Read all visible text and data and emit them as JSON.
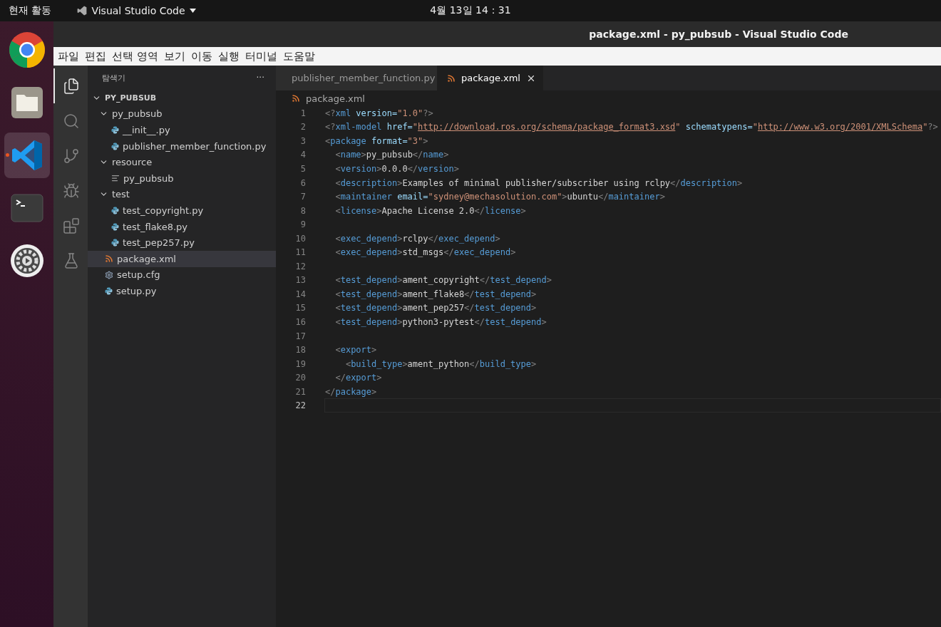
{
  "top_bar": {
    "activities": "현재 활동",
    "app_menu": "Visual Studio Code",
    "clock": "4월 13일 14：31"
  },
  "dock": [
    {
      "kind": "chrome",
      "selected": false,
      "running": false
    },
    {
      "kind": "files",
      "selected": false,
      "running": false
    },
    {
      "kind": "vscode",
      "selected": true,
      "running": true
    },
    {
      "kind": "terminal",
      "selected": false,
      "running": false
    },
    {
      "kind": "settings",
      "selected": false,
      "running": false
    }
  ],
  "window": {
    "title": "package.xml - py_pubsub - Visual Studio Code"
  },
  "menu": [
    "파일",
    "편집",
    "선택 영역",
    "보기",
    "이동",
    "실행",
    "터미널",
    "도움말"
  ],
  "activity_bar": [
    {
      "kind": "explorer",
      "selected": true
    },
    {
      "kind": "search",
      "selected": false
    },
    {
      "kind": "source-control",
      "selected": false
    },
    {
      "kind": "run",
      "selected": false
    },
    {
      "kind": "extensions",
      "selected": false
    },
    {
      "kind": "testing",
      "selected": false
    }
  ],
  "sidebar": {
    "title": "탐색기",
    "more": "···",
    "root": {
      "label": "PY_PUBSUB",
      "expanded": true,
      "children": [
        {
          "label": "py_pubsub",
          "kind": "folder",
          "expanded": true,
          "selected": false,
          "children": [
            {
              "label": "__init__.py",
              "kind": "python",
              "selected": false
            },
            {
              "label": "publisher_member_function.py",
              "kind": "python",
              "selected": false
            }
          ]
        },
        {
          "label": "resource",
          "kind": "folder",
          "expanded": true,
          "selected": false,
          "children": [
            {
              "label": "py_pubsub",
              "kind": "text",
              "selected": false
            }
          ]
        },
        {
          "label": "test",
          "kind": "folder",
          "expanded": true,
          "selected": false,
          "children": [
            {
              "label": "test_copyright.py",
              "kind": "python",
              "selected": false
            },
            {
              "label": "test_flake8.py",
              "kind": "python",
              "selected": false
            },
            {
              "label": "test_pep257.py",
              "kind": "python",
              "selected": false
            }
          ]
        },
        {
          "label": "package.xml",
          "kind": "xml",
          "selected": true
        },
        {
          "label": "setup.cfg",
          "kind": "config",
          "selected": false
        },
        {
          "label": "setup.py",
          "kind": "python",
          "selected": false
        }
      ]
    }
  },
  "tabs": [
    {
      "label": "publisher_member_function.py",
      "kind": "python",
      "selected": false
    },
    {
      "label": "package.xml",
      "kind": "xml",
      "selected": true
    }
  ],
  "breadcrumb": {
    "label": "package.xml",
    "kind": "xml"
  },
  "code": [
    {
      "number": "1",
      "current": false,
      "tokens": [
        {
          "kind": "punct",
          "text": "<?"
        },
        {
          "kind": "tag",
          "text": "xml"
        },
        {
          "kind": "attr",
          "text": " version="
        },
        {
          "kind": "string",
          "text": "\"1.0\""
        },
        {
          "kind": "punct",
          "text": "?>"
        }
      ]
    },
    {
      "number": "2",
      "current": false,
      "tokens": [
        {
          "kind": "punct",
          "text": "<?"
        },
        {
          "kind": "tag",
          "text": "xml-model"
        },
        {
          "kind": "attr",
          "text": " href="
        },
        {
          "kind": "string",
          "text": "\""
        },
        {
          "kind": "link",
          "text": "http://download.ros.org/schema/package_format3.xsd"
        },
        {
          "kind": "string",
          "text": "\""
        },
        {
          "kind": "attr",
          "text": " schematypens="
        },
        {
          "kind": "string",
          "text": "\""
        },
        {
          "kind": "link",
          "text": "http://www.w3.org/2001/XMLSchema"
        },
        {
          "kind": "string",
          "text": "\""
        },
        {
          "kind": "punct",
          "text": "?>"
        }
      ]
    },
    {
      "number": "3",
      "current": false,
      "tokens": [
        {
          "kind": "punct",
          "text": "<"
        },
        {
          "kind": "tag",
          "text": "package"
        },
        {
          "kind": "attr",
          "text": " format="
        },
        {
          "kind": "string",
          "text": "\"3\""
        },
        {
          "kind": "punct",
          "text": ">"
        }
      ]
    },
    {
      "number": "4",
      "current": false,
      "tokens": [
        {
          "kind": "punct",
          "text": "  <"
        },
        {
          "kind": "tag",
          "text": "name"
        },
        {
          "kind": "punct",
          "text": ">"
        },
        {
          "kind": "text",
          "text": "py_pubsub"
        },
        {
          "kind": "punct",
          "text": "</"
        },
        {
          "kind": "tag",
          "text": "name"
        },
        {
          "kind": "punct",
          "text": ">"
        }
      ]
    },
    {
      "number": "5",
      "current": false,
      "tokens": [
        {
          "kind": "punct",
          "text": "  <"
        },
        {
          "kind": "tag",
          "text": "version"
        },
        {
          "kind": "punct",
          "text": ">"
        },
        {
          "kind": "text",
          "text": "0.0.0"
        },
        {
          "kind": "punct",
          "text": "</"
        },
        {
          "kind": "tag",
          "text": "version"
        },
        {
          "kind": "punct",
          "text": ">"
        }
      ]
    },
    {
      "number": "6",
      "current": false,
      "tokens": [
        {
          "kind": "punct",
          "text": "  <"
        },
        {
          "kind": "tag",
          "text": "description"
        },
        {
          "kind": "punct",
          "text": ">"
        },
        {
          "kind": "text",
          "text": "Examples of minimal publisher/subscriber using rclpy"
        },
        {
          "kind": "punct",
          "text": "</"
        },
        {
          "kind": "tag",
          "text": "description"
        },
        {
          "kind": "punct",
          "text": ">"
        }
      ]
    },
    {
      "number": "7",
      "current": false,
      "tokens": [
        {
          "kind": "punct",
          "text": "  <"
        },
        {
          "kind": "tag",
          "text": "maintainer"
        },
        {
          "kind": "attr",
          "text": " email="
        },
        {
          "kind": "string",
          "text": "\"sydney@mechasolution.com\""
        },
        {
          "kind": "punct",
          "text": ">"
        },
        {
          "kind": "text",
          "text": "ubuntu"
        },
        {
          "kind": "punct",
          "text": "</"
        },
        {
          "kind": "tag",
          "text": "maintainer"
        },
        {
          "kind": "punct",
          "text": ">"
        }
      ]
    },
    {
      "number": "8",
      "current": false,
      "tokens": [
        {
          "kind": "punct",
          "text": "  <"
        },
        {
          "kind": "tag",
          "text": "license"
        },
        {
          "kind": "punct",
          "text": ">"
        },
        {
          "kind": "text",
          "text": "Apache License 2.0"
        },
        {
          "kind": "punct",
          "text": "</"
        },
        {
          "kind": "tag",
          "text": "license"
        },
        {
          "kind": "punct",
          "text": ">"
        }
      ]
    },
    {
      "number": "9",
      "current": false
    },
    {
      "number": "10",
      "current": false,
      "tokens": [
        {
          "kind": "punct",
          "text": "  <"
        },
        {
          "kind": "tag",
          "text": "exec_depend"
        },
        {
          "kind": "punct",
          "text": ">"
        },
        {
          "kind": "text",
          "text": "rclpy"
        },
        {
          "kind": "punct",
          "text": "</"
        },
        {
          "kind": "tag",
          "text": "exec_depend"
        },
        {
          "kind": "punct",
          "text": ">"
        }
      ]
    },
    {
      "number": "11",
      "current": false,
      "tokens": [
        {
          "kind": "punct",
          "text": "  <"
        },
        {
          "kind": "tag",
          "text": "exec_depend"
        },
        {
          "kind": "punct",
          "text": ">"
        },
        {
          "kind": "text",
          "text": "std_msgs"
        },
        {
          "kind": "punct",
          "text": "</"
        },
        {
          "kind": "tag",
          "text": "exec_depend"
        },
        {
          "kind": "punct",
          "text": ">"
        }
      ]
    },
    {
      "number": "12",
      "current": false
    },
    {
      "number": "13",
      "current": false,
      "tokens": [
        {
          "kind": "punct",
          "text": "  <"
        },
        {
          "kind": "tag",
          "text": "test_depend"
        },
        {
          "kind": "punct",
          "text": ">"
        },
        {
          "kind": "text",
          "text": "ament_copyright"
        },
        {
          "kind": "punct",
          "text": "</"
        },
        {
          "kind": "tag",
          "text": "test_depend"
        },
        {
          "kind": "punct",
          "text": ">"
        }
      ]
    },
    {
      "number": "14",
      "current": false,
      "tokens": [
        {
          "kind": "punct",
          "text": "  <"
        },
        {
          "kind": "tag",
          "text": "test_depend"
        },
        {
          "kind": "punct",
          "text": ">"
        },
        {
          "kind": "text",
          "text": "ament_flake8"
        },
        {
          "kind": "punct",
          "text": "</"
        },
        {
          "kind": "tag",
          "text": "test_depend"
        },
        {
          "kind": "punct",
          "text": ">"
        }
      ]
    },
    {
      "number": "15",
      "current": false,
      "tokens": [
        {
          "kind": "punct",
          "text": "  <"
        },
        {
          "kind": "tag",
          "text": "test_depend"
        },
        {
          "kind": "punct",
          "text": ">"
        },
        {
          "kind": "text",
          "text": "ament_pep257"
        },
        {
          "kind": "punct",
          "text": "</"
        },
        {
          "kind": "tag",
          "text": "test_depend"
        },
        {
          "kind": "punct",
          "text": ">"
        }
      ]
    },
    {
      "number": "16",
      "current": false,
      "tokens": [
        {
          "kind": "punct",
          "text": "  <"
        },
        {
          "kind": "tag",
          "text": "test_depend"
        },
        {
          "kind": "punct",
          "text": ">"
        },
        {
          "kind": "text",
          "text": "python3-pytest"
        },
        {
          "kind": "punct",
          "text": "</"
        },
        {
          "kind": "tag",
          "text": "test_depend"
        },
        {
          "kind": "punct",
          "text": ">"
        }
      ]
    },
    {
      "number": "17",
      "current": false
    },
    {
      "number": "18",
      "current": false,
      "tokens": [
        {
          "kind": "punct",
          "text": "  <"
        },
        {
          "kind": "tag",
          "text": "export"
        },
        {
          "kind": "punct",
          "text": ">"
        }
      ]
    },
    {
      "number": "19",
      "current": false,
      "tokens": [
        {
          "kind": "punct",
          "text": "    <"
        },
        {
          "kind": "tag",
          "text": "build_type"
        },
        {
          "kind": "punct",
          "text": ">"
        },
        {
          "kind": "text",
          "text": "ament_python"
        },
        {
          "kind": "punct",
          "text": "</"
        },
        {
          "kind": "tag",
          "text": "build_type"
        },
        {
          "kind": "punct",
          "text": ">"
        }
      ]
    },
    {
      "number": "20",
      "current": false,
      "tokens": [
        {
          "kind": "punct",
          "text": "  </"
        },
        {
          "kind": "tag",
          "text": "export"
        },
        {
          "kind": "punct",
          "text": ">"
        }
      ]
    },
    {
      "number": "21",
      "current": false,
      "tokens": [
        {
          "kind": "punct",
          "text": "</"
        },
        {
          "kind": "tag",
          "text": "package"
        },
        {
          "kind": "punct",
          "text": ">"
        }
      ]
    },
    {
      "number": "22",
      "current": true
    }
  ]
}
